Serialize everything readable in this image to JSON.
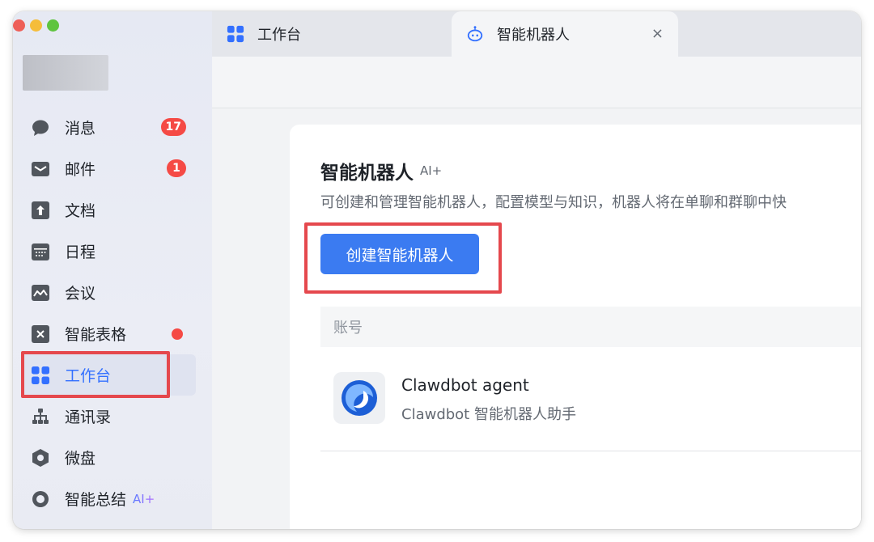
{
  "sidebar": {
    "items": [
      {
        "key": "messages",
        "label": "消息",
        "icon": "chat-bubble-icon",
        "badge": "17"
      },
      {
        "key": "mail",
        "label": "邮件",
        "icon": "mail-icon",
        "badge": "1"
      },
      {
        "key": "docs",
        "label": "文档",
        "icon": "docs-icon"
      },
      {
        "key": "calendar",
        "label": "日程",
        "icon": "calendar-icon"
      },
      {
        "key": "meetings",
        "label": "会议",
        "icon": "meeting-icon"
      },
      {
        "key": "smart-sheet",
        "label": "智能表格",
        "icon": "smart-sheet-icon",
        "dot": true
      },
      {
        "key": "workbench",
        "label": "工作台",
        "icon": "workbench-grid-icon",
        "active": true
      },
      {
        "key": "contacts",
        "label": "通讯录",
        "icon": "org-chart-icon"
      },
      {
        "key": "drive",
        "label": "微盘",
        "icon": "drive-icon"
      },
      {
        "key": "summary",
        "label": "智能总结",
        "icon": "summary-icon",
        "ai_tag": "AI+"
      }
    ]
  },
  "tabs": [
    {
      "label": "工作台",
      "icon": "workbench-grid-icon"
    },
    {
      "label": "智能机器人",
      "icon": "robot-icon",
      "close": "×",
      "active": true
    }
  ],
  "page": {
    "title": "智能机器人",
    "ai_tag": "AI+",
    "description": "可创建和管理智能机器人，配置模型与知识，机器人将在单聊和群聊中快",
    "create_button": "创建智能机器人",
    "table_header": "账号",
    "bots": [
      {
        "name": "Clawdbot agent",
        "description": "Clawdbot 智能机器人助手"
      }
    ]
  },
  "colors": {
    "accent": "#3b7bf1",
    "badge": "#f54a45",
    "highlight": "#e5484d"
  }
}
